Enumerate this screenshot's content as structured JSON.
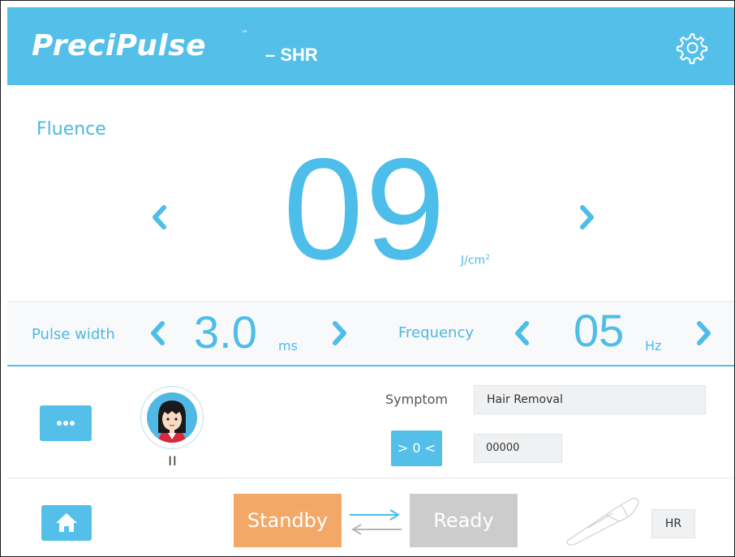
{
  "header": {
    "brand": "PreciPulse",
    "trademark": "™",
    "model": "– SHR",
    "settings_icon": "gear-icon"
  },
  "fluence": {
    "label": "Fluence",
    "value": "09",
    "unit": "J/cm",
    "unit_sup": "2",
    "decrease_icon": "chevron-left-icon",
    "increase_icon": "chevron-right-icon"
  },
  "pulse_width": {
    "label": "Pulse width",
    "value": "3.0",
    "unit": "ms"
  },
  "frequency": {
    "label": "Frequency",
    "value": "05",
    "unit": "Hz"
  },
  "middle": {
    "more_icon": "ellipsis-icon",
    "skin_type": "II",
    "symptom_label": "Symptom",
    "symptom_value": "Hair Removal",
    "reset_label": "> 0 <",
    "counter_value": "00000"
  },
  "bottom": {
    "home_icon": "home-icon",
    "standby_label": "Standby",
    "ready_label": "Ready",
    "handpiece_label": "HR"
  },
  "colors": {
    "accent": "#54c0ea",
    "value_blue": "#4dbde9",
    "standby": "#f4a868",
    "ready_disabled": "#cccccc"
  }
}
